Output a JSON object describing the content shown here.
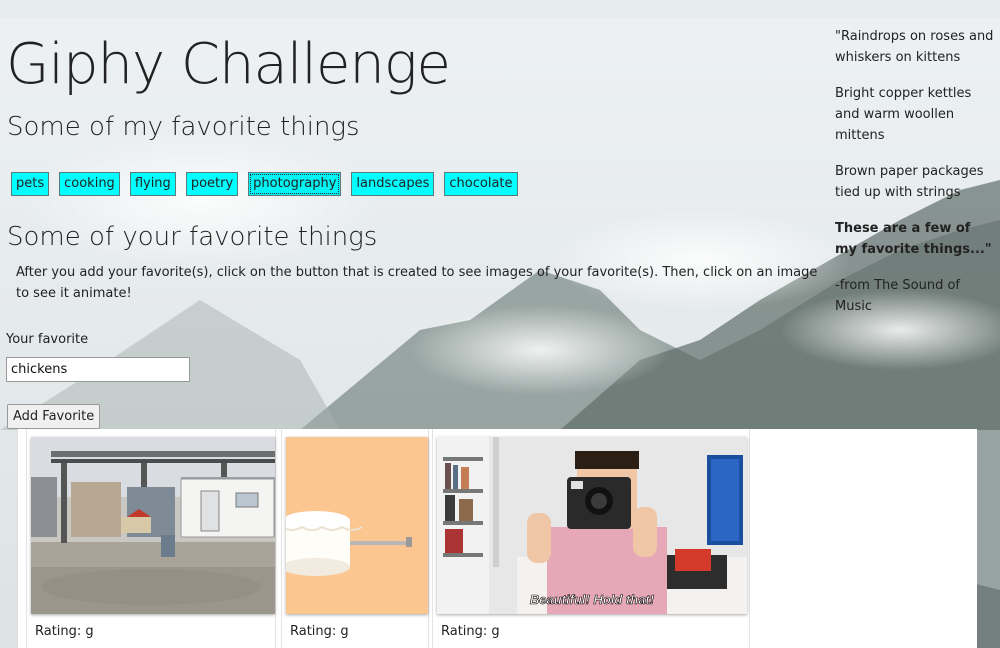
{
  "header": {
    "title": "Giphy Challenge",
    "subtitle": "Some of my favorite things"
  },
  "topics": [
    "pets",
    "cooking",
    "flying",
    "poetry",
    "photography",
    "landscapes",
    "chocolate"
  ],
  "your_section": {
    "title": "Some of your favorite things",
    "instructions": "After you add your favorite(s), click on the button that is created to see images of your favorite(s). Then, click on an image to see it animate!",
    "field_label": "Your favorite",
    "input_value": "chickens",
    "add_button": "Add Favorite"
  },
  "gifs": [
    {
      "rating": "Rating: g",
      "image": "construction-site-trailer"
    },
    {
      "rating": "Rating: g",
      "image": "cake-on-peach-background"
    },
    {
      "rating": "Rating: g",
      "image": "man-with-polaroid-camera",
      "caption": "Beautiful! Hold that!"
    }
  ],
  "sidebar": {
    "line1": "\"Raindrops on roses and whiskers on kittens",
    "line2": "Bright copper kettles and warm woollen mittens",
    "line3": "Brown paper packages tied up with strings",
    "line4": "These are a few of my favorite things...\"",
    "credit": "-from The Sound of Music"
  },
  "colors": {
    "topic_button": "#00ffff",
    "background": "#e9eef1"
  }
}
